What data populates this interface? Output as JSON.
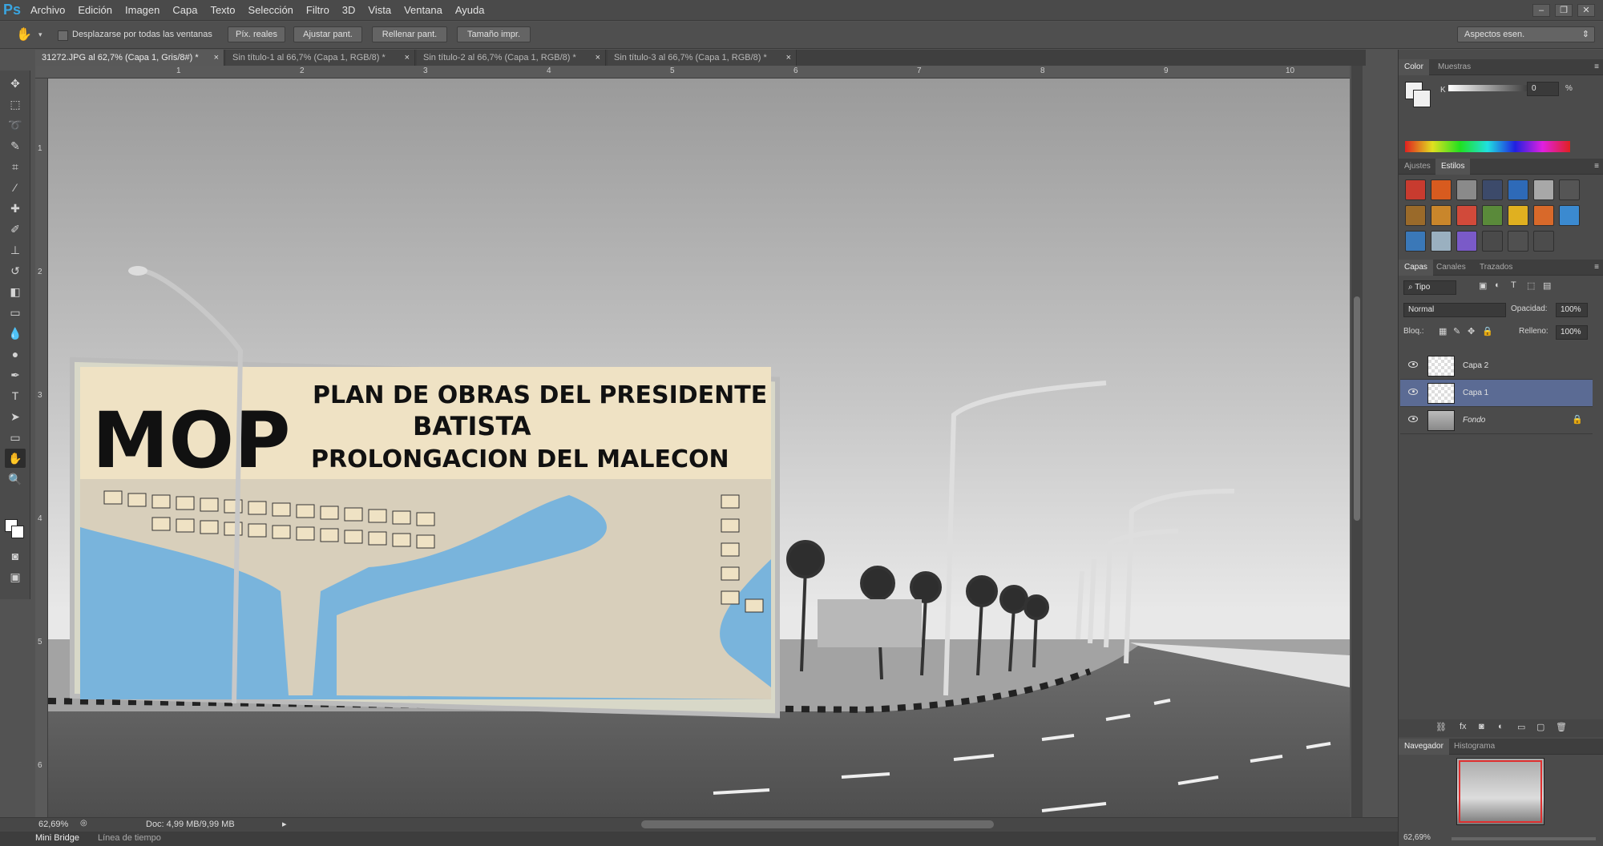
{
  "menubar": {
    "logo": "Ps",
    "items": [
      "Archivo",
      "Edición",
      "Imagen",
      "Capa",
      "Texto",
      "Selección",
      "Filtro",
      "3D",
      "Vista",
      "Ventana",
      "Ayuda"
    ]
  },
  "optionsbar": {
    "checkbox_label": "Desplazarse por todas las ventanas",
    "buttons": [
      "Píx. reales",
      "Ajustar pant.",
      "Rellenar pant.",
      "Tamaño impr."
    ],
    "workspace": "Aspectos esen."
  },
  "doc_tabs": [
    {
      "label": "31272.JPG al 62,7% (Capa 1, Gris/8#) *",
      "active": true
    },
    {
      "label": "Sin título-1 al 66,7% (Capa 1, RGB/8) *",
      "active": false
    },
    {
      "label": "Sin título-2 al 66,7% (Capa 1, RGB/8) *",
      "active": false
    },
    {
      "label": "Sin título-3 al 66,7% (Capa 1, RGB/8) *",
      "active": false
    }
  ],
  "ruler_top": [
    "1",
    "2",
    "3",
    "4",
    "5",
    "6",
    "7",
    "8",
    "9",
    "10"
  ],
  "ruler_left": [
    "1",
    "2",
    "3",
    "4",
    "5",
    "6"
  ],
  "billboard": {
    "big": "MOP",
    "line1": "PLAN DE OBRAS DEL PRESIDENTE",
    "line2": "BATISTA",
    "line3": "PROLONGACION  DEL  MALECON"
  },
  "status": {
    "zoom": "62,69%",
    "doc": "Doc: 4,99 MB/9,99 MB"
  },
  "bottom_tabs": [
    "Mini Bridge",
    "Línea de tiempo"
  ],
  "color_panel": {
    "tabs": [
      "Color",
      "Muestras"
    ],
    "channel": "K",
    "value": "0",
    "unit": "%"
  },
  "styles_panel": {
    "tabs": [
      "Ajustes",
      "Estilos"
    ],
    "swatches": [
      "#c83b2f",
      "#d85b1f",
      "#8a8a8a",
      "#3c4a6a",
      "#2e6ab8",
      "#a8a8a8",
      "#555555",
      "#9a6a2a",
      "#c9862b",
      "#d14a3a",
      "#5a8a3a",
      "#e0b020",
      "#d8692a",
      "#3b8ad0",
      "#3a78b8",
      "#9ab0c0",
      "#7a5ac8",
      "#4a4a4a",
      "#505050",
      "#4c4c4c"
    ]
  },
  "layers_panel": {
    "tabs": [
      "Capas",
      "Canales",
      "Trazados"
    ],
    "filter": "Tipo",
    "blend": "Normal",
    "opacity_label": "Opacidad:",
    "opacity": "100%",
    "lock_label": "Bloq.:",
    "fill_label": "Relleno:",
    "fill": "100%",
    "layers": [
      {
        "name": "Capa 2",
        "selected": false
      },
      {
        "name": "Capa 1",
        "selected": true
      },
      {
        "name": "Fondo",
        "selected": false
      }
    ]
  },
  "navigator": {
    "tabs": [
      "Navegador",
      "Histograma"
    ],
    "zoom": "62,69%"
  },
  "colors": {
    "accent": "#3aa5e0",
    "selection": "#5b6b94",
    "billboard_cream": "#efe2c4",
    "water_blue": "#79b4dc"
  }
}
